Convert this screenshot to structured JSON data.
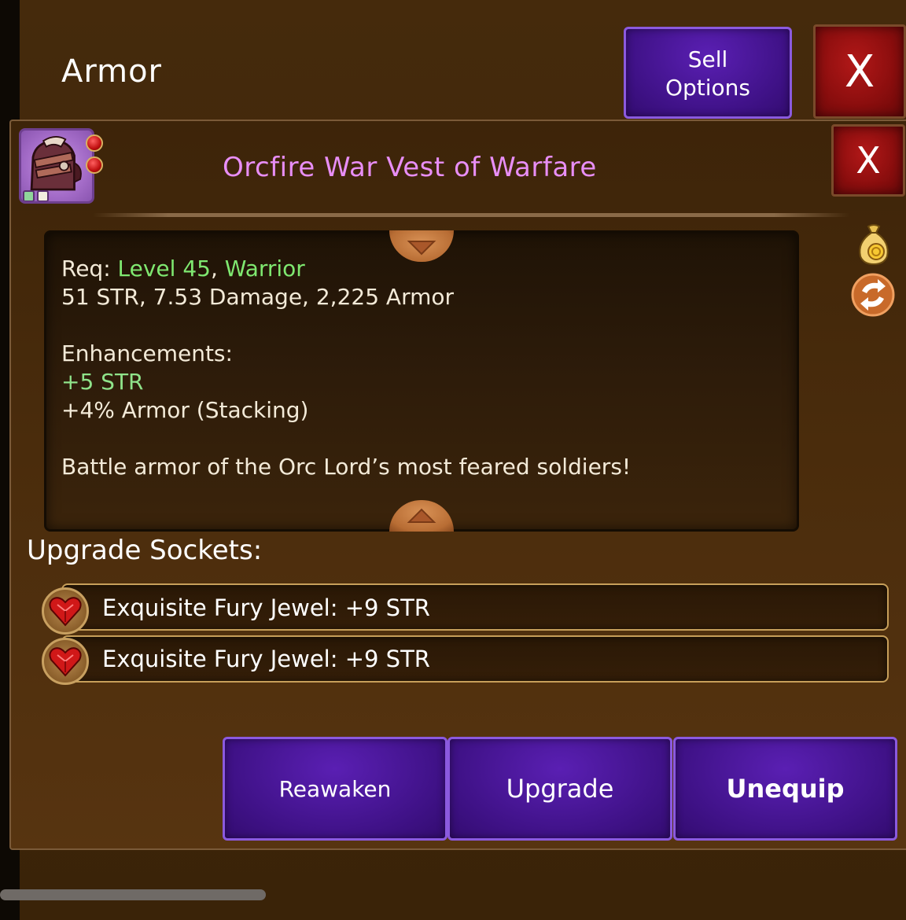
{
  "header": {
    "title": "Armor",
    "sell_options_label_line1": "Sell",
    "sell_options_label_line2": "Options",
    "close_label": "X"
  },
  "item": {
    "name": "Orcfire War Vest of Warfare",
    "close_label": "X",
    "name_color": "#e88ef6",
    "icon": "orc-helmet-armor-icon",
    "gem_count": 2
  },
  "description": {
    "req_prefix": "Req: ",
    "req_level": "Level 45",
    "req_separator": ", ",
    "req_class": "Warrior",
    "stats": "51 STR, 7.53 Damage, 2,225 Armor",
    "enhancements_title": "Enhancements:",
    "enhancement_1": "+5 STR",
    "enhancement_2": "+4% Armor (Stacking)",
    "flavor": "Battle armor of the Orc Lord’s most feared soldiers!"
  },
  "side_icons": [
    "gold-bag-icon",
    "swap-icon"
  ],
  "sockets": {
    "title": "Upgrade Sockets:",
    "items": [
      {
        "label": "Exquisite Fury Jewel: +9 STR",
        "icon": "ruby-heart-gem-icon"
      },
      {
        "label": "Exquisite Fury Jewel: +9 STR",
        "icon": "ruby-heart-gem-icon"
      }
    ]
  },
  "actions": {
    "reawaken": "Reawaken",
    "upgrade": "Upgrade",
    "unequip": "Unequip"
  },
  "colors": {
    "background": "#3a2308",
    "button_purple": "#3e1185",
    "button_red": "#8c0e0e",
    "accent_green": "#7fe870"
  }
}
